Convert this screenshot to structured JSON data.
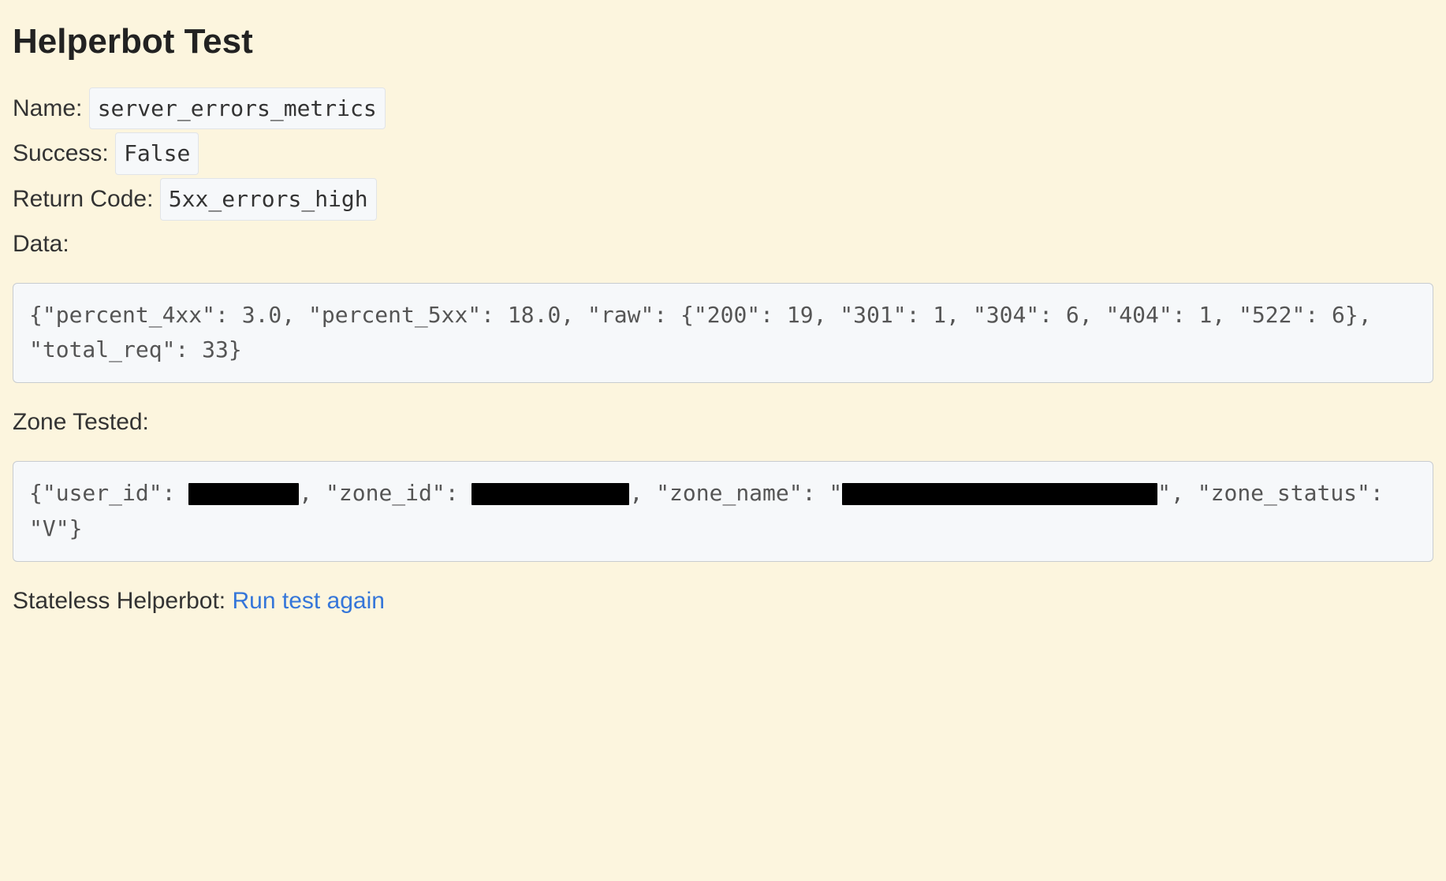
{
  "title": "Helperbot Test",
  "fields": {
    "name_label": "Name:",
    "name_value": "server_errors_metrics",
    "success_label": "Success:",
    "success_value": "False",
    "return_code_label": "Return Code:",
    "return_code_value": "5xx_errors_high",
    "data_label": "Data:",
    "zone_tested_label": "Zone Tested:",
    "stateless_label": "Stateless Helperbot: ",
    "run_again_link": "Run test again"
  },
  "data_block": "{\"percent_4xx\": 3.0, \"percent_5xx\": 18.0, \"raw\": {\"200\": 19, \"301\": 1, \"304\": 6, \"404\": 1, \"522\": 6}, \"total_req\": 33}",
  "zone_block": {
    "prefix": "{\"user_id\": ",
    "mid1": ", \"zone_id\": ",
    "mid2": ", \"zone_name\": \"",
    "suffix": "\", \"zone_status\": \"V\"}"
  }
}
